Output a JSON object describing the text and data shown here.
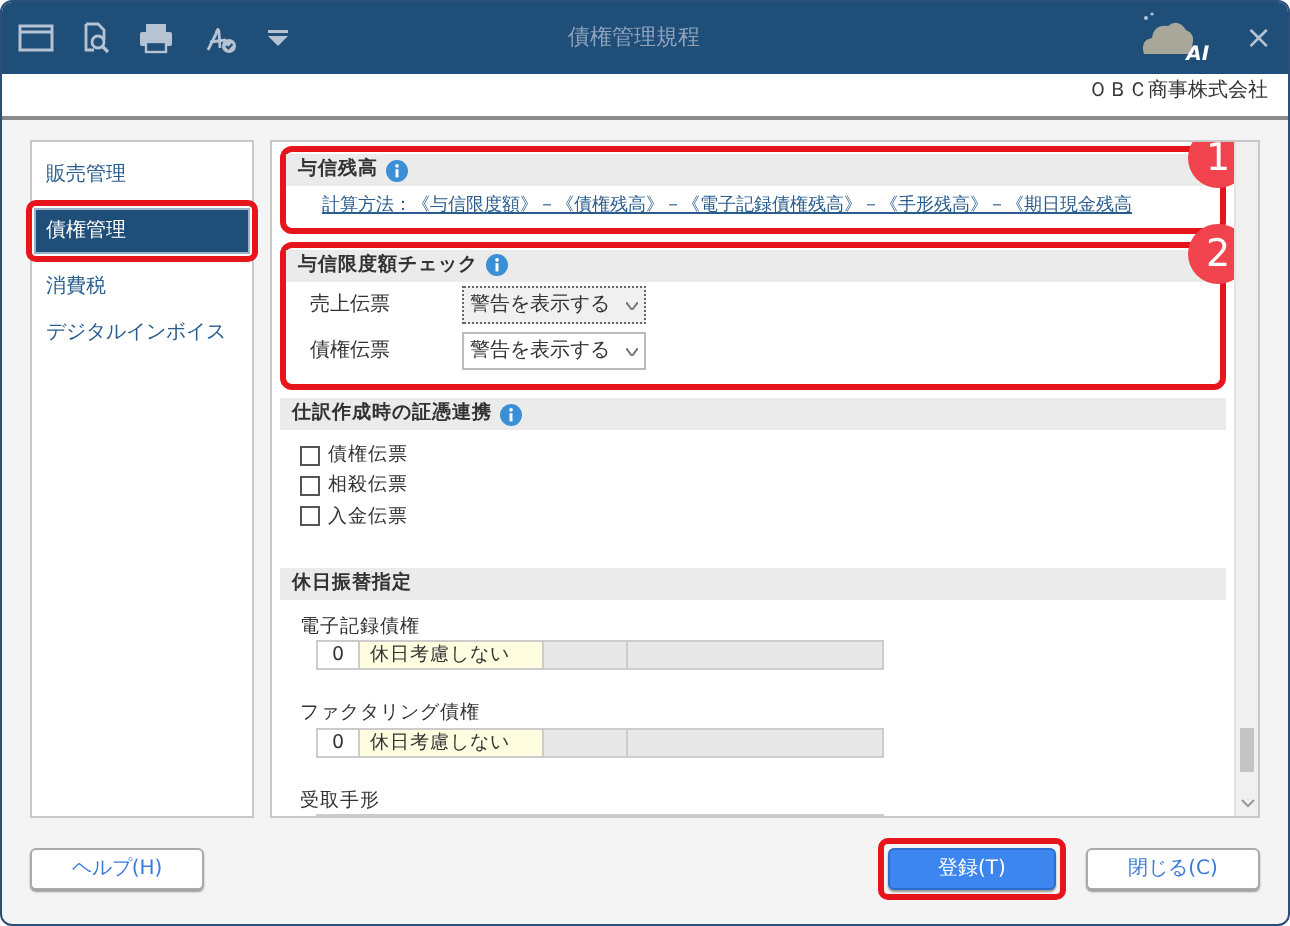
{
  "window": {
    "title": "債権管理規程",
    "ai_badge": "AI",
    "close": "×"
  },
  "company": "ＯＢＣ商事株式会社",
  "sidebar": {
    "items": [
      {
        "label": "販売管理",
        "selected": false,
        "highlighted": false
      },
      {
        "label": "債権管理",
        "selected": true,
        "highlighted": true
      },
      {
        "label": "消費税",
        "selected": false,
        "highlighted": false
      },
      {
        "label": "デジタルインボイス",
        "selected": false,
        "highlighted": false
      }
    ]
  },
  "sections": [
    {
      "kind": "link",
      "title": "与信残高",
      "info": true,
      "callout": "1",
      "link": "計算方法：《与信限度額》－《債権残高》－《電子記録債権残高》－《手形残高》－《期日現金残高"
    },
    {
      "kind": "selects",
      "title": "与信限度額チェック",
      "info": true,
      "callout": "2",
      "rows": [
        {
          "label": "売上伝票",
          "value": "警告を表示する",
          "focused": true
        },
        {
          "label": "債権伝票",
          "value": "警告を表示する",
          "focused": false
        }
      ]
    },
    {
      "kind": "checks",
      "title": "仕訳作成時の証憑連携",
      "info": true,
      "items": [
        {
          "label": "債権伝票",
          "checked": false
        },
        {
          "label": "相殺伝票",
          "checked": false
        },
        {
          "label": "入金伝票",
          "checked": false
        }
      ]
    },
    {
      "kind": "holidays",
      "title": "休日振替指定",
      "items": [
        {
          "label": "電子記録債権",
          "number": "0",
          "option": "休日考慮しない"
        },
        {
          "label": "ファクタリング債権",
          "number": "0",
          "option": "休日考慮しない"
        },
        {
          "label": "受取手形"
        }
      ]
    }
  ],
  "buttons": [
    {
      "label": "ヘルプ(H)",
      "primary": false,
      "highlighted": false
    },
    {
      "label": "登録(T)",
      "primary": true,
      "highlighted": true
    },
    {
      "label": "閉じる(C)",
      "primary": false,
      "highlighted": false
    }
  ]
}
